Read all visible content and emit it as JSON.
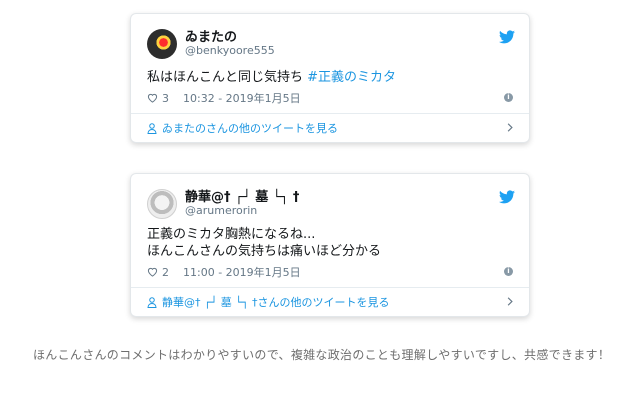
{
  "tweets": [
    {
      "name": "ゐまたの",
      "handle": "@benkyoore555",
      "text_plain": "私はほんこんと同じ気持ち ",
      "hashtag": "#正義のミカタ",
      "likes": "3",
      "timestamp": "10:32 - 2019年1月5日",
      "footer_link": "ゐまたのさんの他のツイートを見る"
    },
    {
      "name": "静華@† ┌┘ 墓 └┐ †",
      "handle": "@arumerorin",
      "text_line1": "正義のミカタ胸熱になるね...",
      "text_line2": "ほんこんさんの気持ちは痛いほど分かる",
      "likes": "2",
      "timestamp": "11:00 - 2019年1月5日",
      "footer_link": "静華@† ┌┘ 墓 └┐ †さんの他のツイートを見る"
    }
  ],
  "comment": "ほんこんさんのコメントはわかりやすいので、複雑な政治のことも理解しやすいですし、共感できます！",
  "colors": {
    "accent": "#1b95e0",
    "muted": "#657786",
    "comment_text": "#6e6e6e"
  },
  "icons": [
    "twitter-bird-icon",
    "heart-icon",
    "info-icon",
    "person-icon",
    "chevron-right-icon"
  ]
}
